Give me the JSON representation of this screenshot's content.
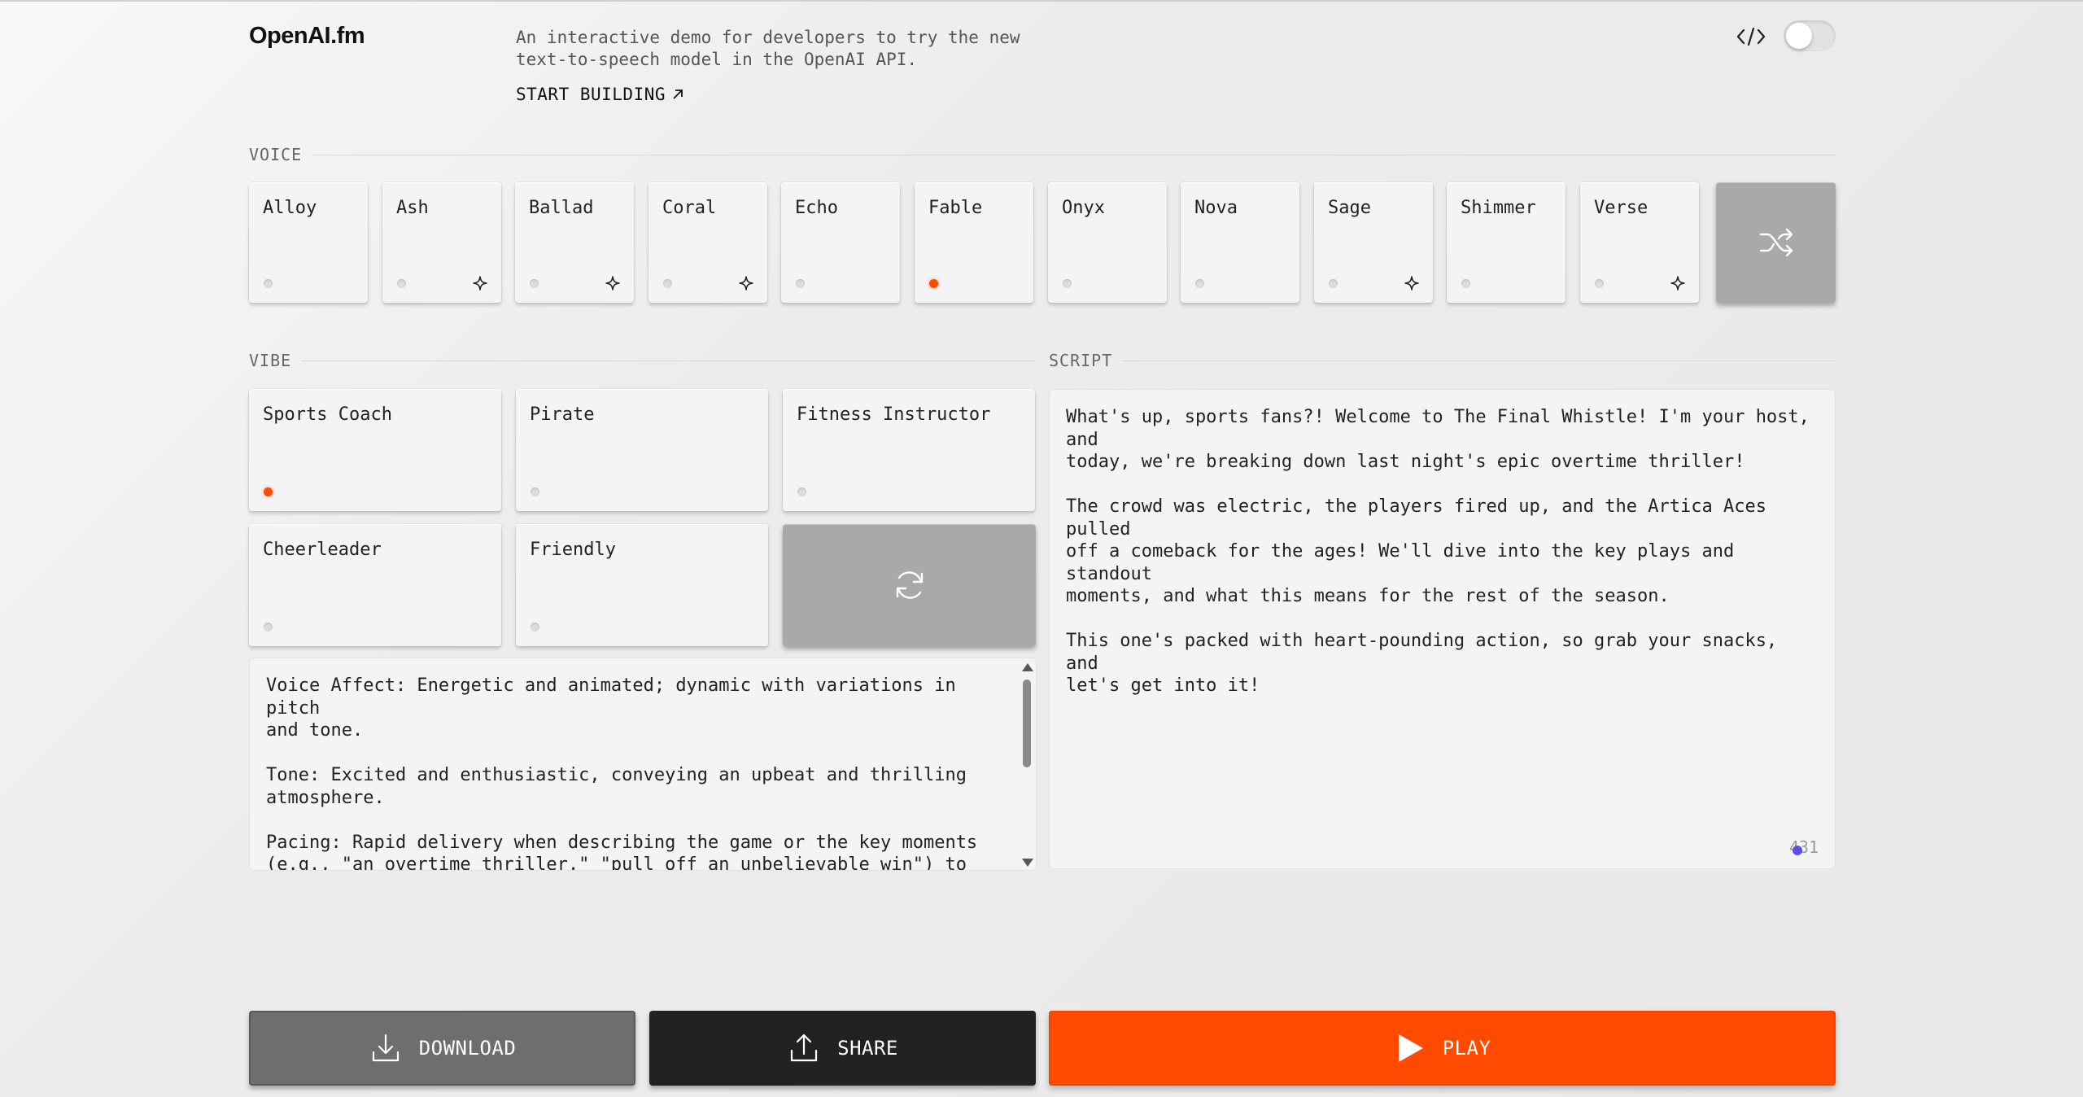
{
  "header": {
    "logo": "OpenAI.fm",
    "description": "An interactive demo for developers to try the new text-to-speech model in the OpenAI API.",
    "start_building": "START BUILDING",
    "start_building_icon": "arrow-up-right-icon",
    "code_icon": "code-icon",
    "dev_mode_on": false
  },
  "voice": {
    "label": "VOICE",
    "items": [
      {
        "label": "Alloy",
        "selected": false,
        "sparkle": false
      },
      {
        "label": "Ash",
        "selected": false,
        "sparkle": true
      },
      {
        "label": "Ballad",
        "selected": false,
        "sparkle": true
      },
      {
        "label": "Coral",
        "selected": false,
        "sparkle": true
      },
      {
        "label": "Echo",
        "selected": false,
        "sparkle": false
      },
      {
        "label": "Fable",
        "selected": true,
        "sparkle": false
      },
      {
        "label": "Onyx",
        "selected": false,
        "sparkle": false
      },
      {
        "label": "Nova",
        "selected": false,
        "sparkle": false
      },
      {
        "label": "Sage",
        "selected": false,
        "sparkle": true
      },
      {
        "label": "Shimmer",
        "selected": false,
        "sparkle": false
      },
      {
        "label": "Verse",
        "selected": false,
        "sparkle": true
      }
    ],
    "shuffle_icon": "shuffle-icon"
  },
  "vibe": {
    "label": "VIBE",
    "items": [
      {
        "label": "Sports Coach",
        "selected": true
      },
      {
        "label": "Pirate",
        "selected": false
      },
      {
        "label": "Fitness Instructor",
        "selected": false
      },
      {
        "label": "Cheerleader",
        "selected": false
      },
      {
        "label": "Friendly",
        "selected": false
      }
    ],
    "refresh_icon": "refresh-icon",
    "text": "Voice Affect: Energetic and animated; dynamic with variations in pitch\nand tone.\n\nTone: Excited and enthusiastic, conveying an upbeat and thrilling\natmosphere.\n\nPacing: Rapid delivery when describing the game or the key moments\n(e.g., \"an overtime thriller,\" \"pull off an unbelievable win\") to\nconvey the intensity and build excitement."
  },
  "script": {
    "label": "SCRIPT",
    "text": "What's up, sports fans?! Welcome to The Final Whistle! I'm your host, and\ntoday, we're breaking down last night's epic overtime thriller!\n\nThe crowd was electric, the players fired up, and the Artica Aces pulled\noff a comeback for the ages! We'll dive into the key plays and standout\nmoments, and what this means for the rest of the season.\n\nThis one's packed with heart-pounding action, so grab your snacks, and\nlet's get into it!",
    "char_count": "431"
  },
  "actions": {
    "download": "DOWNLOAD",
    "share": "SHARE",
    "play": "PLAY"
  },
  "colors": {
    "accent": "#ff4a00",
    "dark": "#222222",
    "gray_button": "#6e6e6e"
  }
}
